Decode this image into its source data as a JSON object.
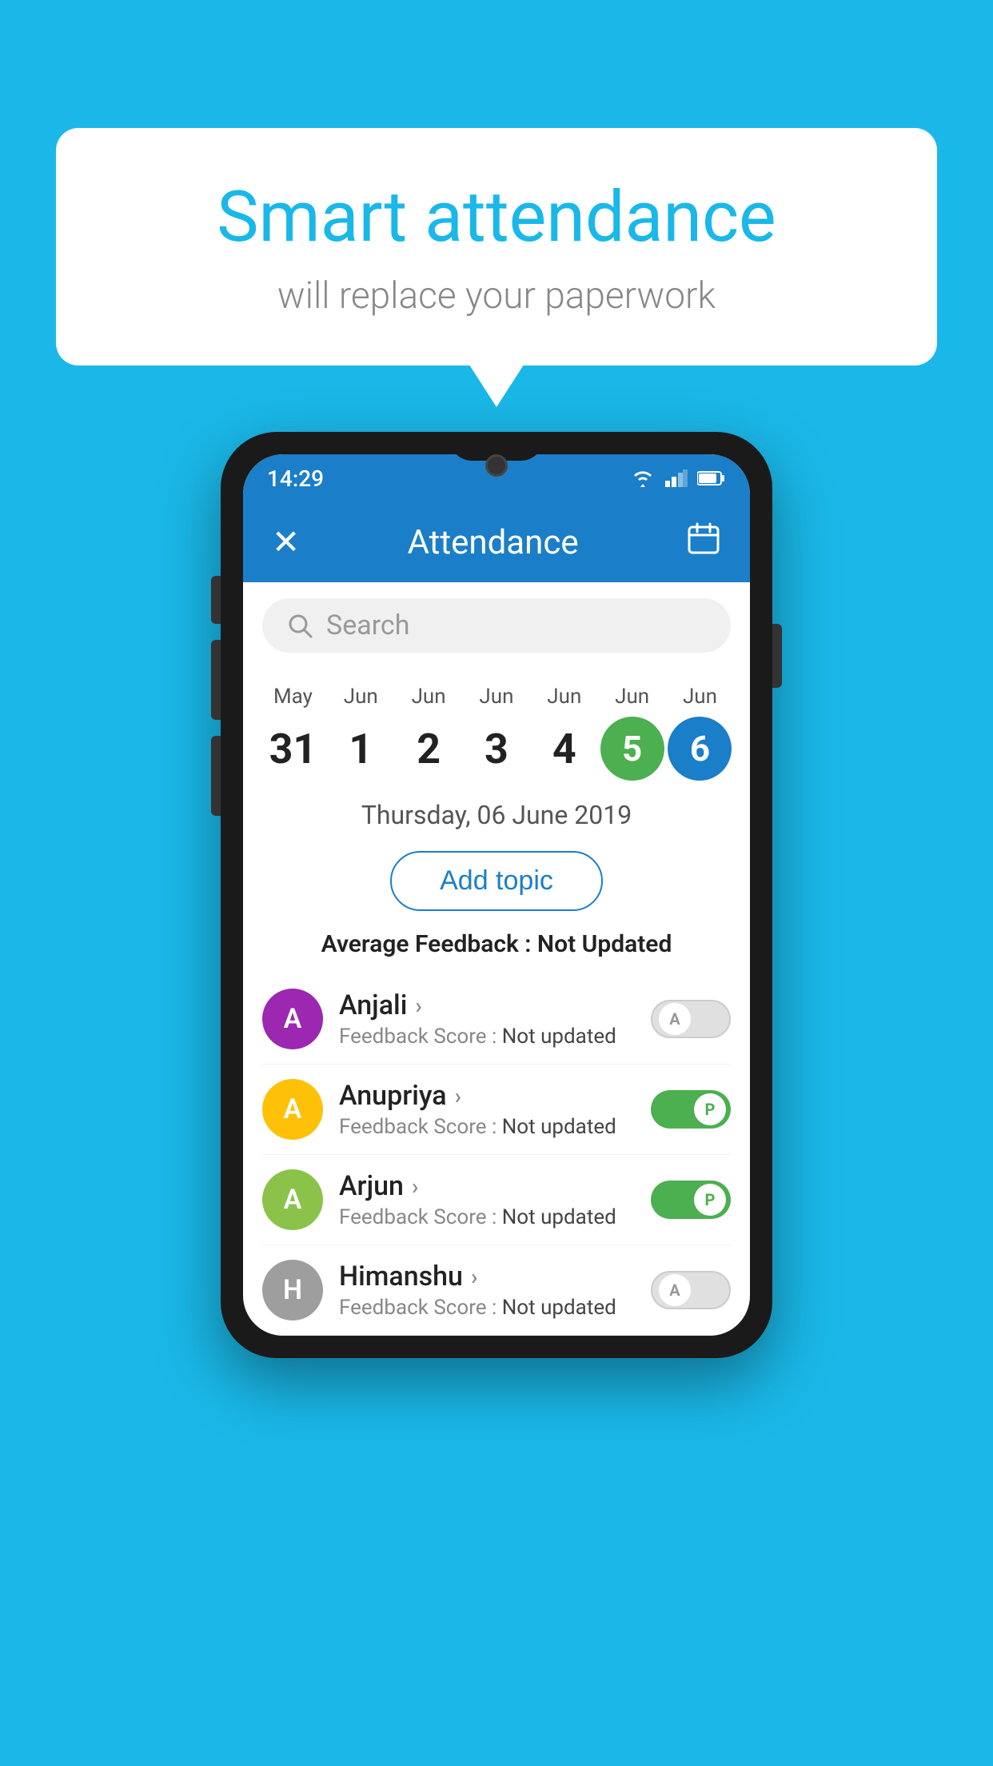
{
  "background_color": "#1ab8e8",
  "speech_bubble": {
    "title": "Smart attendance",
    "subtitle": "will replace your paperwork"
  },
  "phone": {
    "status_bar": {
      "time": "14:29"
    },
    "app_bar": {
      "title": "Attendance",
      "close_label": "✕",
      "calendar_icon_label": "📅"
    },
    "search": {
      "placeholder": "Search"
    },
    "calendar": {
      "days": [
        {
          "month": "May",
          "date": "31",
          "state": "normal"
        },
        {
          "month": "Jun",
          "date": "1",
          "state": "normal"
        },
        {
          "month": "Jun",
          "date": "2",
          "state": "normal"
        },
        {
          "month": "Jun",
          "date": "3",
          "state": "normal"
        },
        {
          "month": "Jun",
          "date": "4",
          "state": "normal"
        },
        {
          "month": "Jun",
          "date": "5",
          "state": "today"
        },
        {
          "month": "Jun",
          "date": "6",
          "state": "selected"
        }
      ]
    },
    "selected_date_label": "Thursday, 06 June 2019",
    "add_topic_button": "Add topic",
    "avg_feedback_label": "Average Feedback :",
    "avg_feedback_value": "Not Updated",
    "students": [
      {
        "name": "Anjali",
        "initial": "A",
        "avatar_color": "#9c27b0",
        "score_label": "Feedback Score :",
        "score_value": "Not updated",
        "toggle": "off",
        "toggle_letter": "A"
      },
      {
        "name": "Anupriya",
        "initial": "A",
        "avatar_color": "#ffc107",
        "score_label": "Feedback Score :",
        "score_value": "Not updated",
        "toggle": "on",
        "toggle_letter": "P"
      },
      {
        "name": "Arjun",
        "initial": "A",
        "avatar_color": "#8bc34a",
        "score_label": "Feedback Score :",
        "score_value": "Not updated",
        "toggle": "on",
        "toggle_letter": "P"
      },
      {
        "name": "Himanshu",
        "initial": "H",
        "avatar_color": "#9e9e9e",
        "score_label": "Feedback Score :",
        "score_value": "Not updated",
        "toggle": "off",
        "toggle_letter": "A"
      }
    ]
  }
}
